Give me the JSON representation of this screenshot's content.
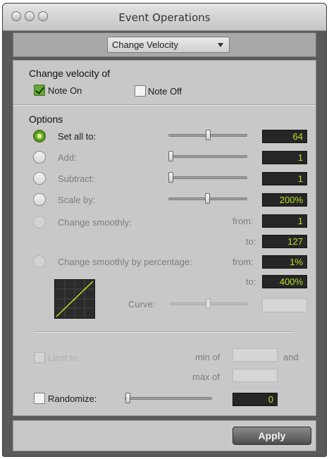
{
  "window": {
    "title": "Event Operations"
  },
  "operation": {
    "selected": "Change Velocity"
  },
  "change_velocity_of": {
    "heading": "Change velocity of",
    "note_on": {
      "label": "Note On",
      "checked": true
    },
    "note_off": {
      "label": "Note Off",
      "checked": false
    }
  },
  "options": {
    "heading": "Options",
    "set_all": {
      "label": "Set all to:",
      "value": "64",
      "selected": true
    },
    "add": {
      "label": "Add:",
      "value": "1"
    },
    "subtract": {
      "label": "Subtract:",
      "value": "1"
    },
    "scale": {
      "label": "Scale by:",
      "value": "200%"
    },
    "smooth": {
      "label": "Change smoothly:",
      "from_label": "from:",
      "from_value": "1",
      "to_label": "to:",
      "to_value": "127"
    },
    "smooth_pct": {
      "label": "Change smoothly by percentage:",
      "from_label": "from:",
      "from_value": "1%",
      "to_label": "to:",
      "to_value": "400%"
    },
    "curve": {
      "label": "Curve:"
    }
  },
  "limit": {
    "label": "Limit to",
    "min_label": "min of",
    "and_label": "and",
    "max_label": "max of"
  },
  "randomize": {
    "label": "Randomize:",
    "value": "0"
  },
  "apply_label": "Apply",
  "colors": {
    "accent_green": "#b8e22a",
    "field_bg": "#262626",
    "panel_bg": "#c8c8c8"
  }
}
